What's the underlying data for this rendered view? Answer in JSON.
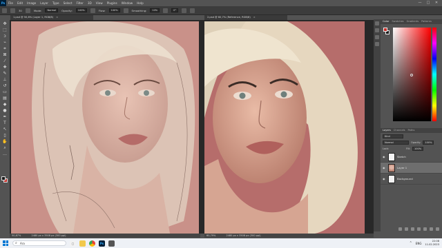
{
  "menu": {
    "app_logo": "Ps",
    "items": [
      "File",
      "Edit",
      "Image",
      "Layer",
      "Type",
      "Select",
      "Filter",
      "3D",
      "View",
      "Plugins",
      "Window",
      "Help"
    ],
    "window_controls": [
      "—",
      "□",
      "✕"
    ]
  },
  "options": {
    "brush_size": "30",
    "mode_label": "Mode:",
    "mode_value": "Normal",
    "opacity_label": "Opacity:",
    "opacity_value": "100%",
    "flow_label": "Flow:",
    "flow_value": "100%",
    "smoothing_label": "Smoothing:",
    "smoothing_value": "10%",
    "angle_value": "0°"
  },
  "tabs": {
    "left": "1.psd @ 50,8% (Layer 1, RGB/8)",
    "right": "2.psd @ 60,7% (Reference, RGB/8)",
    "close": "×"
  },
  "status": {
    "left_zoom": "50,87%",
    "left_doc": "2480 px x 3508 px (300 ppi)",
    "right_zoom": "60,79%",
    "right_doc": "2480 px x 3508 px (300 ppi)"
  },
  "color_panel": {
    "tabs": [
      "Color",
      "Swatches",
      "Gradients",
      "Patterns"
    ],
    "foreground": "#c8302a",
    "background": "#1a1a1a"
  },
  "layers_panel": {
    "tabs": [
      "Layers",
      "Channels",
      "Paths"
    ],
    "filter_kind": "Kind",
    "blend_mode": "Normal",
    "opacity_label": "Opacity:",
    "opacity_value": "100%",
    "lock_label": "Lock:",
    "fill_label": "Fill:",
    "fill_value": "100%",
    "layers": [
      {
        "name": "Sketch",
        "visible": true,
        "selected": false,
        "thumb": "white"
      },
      {
        "name": "Layer 1",
        "visible": true,
        "selected": true,
        "thumb": "portrait"
      },
      {
        "name": "Background",
        "visible": true,
        "selected": false,
        "thumb": "white"
      }
    ]
  },
  "taskbar": {
    "search_placeholder": "Ara",
    "language": "ENG",
    "time": "22:08",
    "date": "11.02.2023"
  },
  "colors": {
    "canvas_pink": "#c99189",
    "reference_bg": "#b66d6b",
    "accent": "#31a8ff"
  }
}
